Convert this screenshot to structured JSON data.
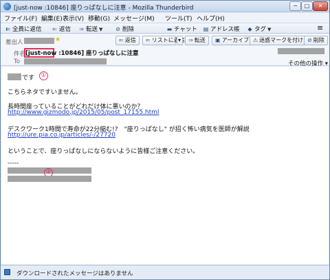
{
  "window": {
    "title": "[just-now :10846] 座りっぱなしに注意 - Mozilla Thunderbird",
    "buttons": {
      "minimize": "─",
      "maximize": "□",
      "close": "✕"
    }
  },
  "menu": [
    "ファイル(F)",
    "編集(E)",
    "表示(V)",
    "移動(G)",
    "メッセージ(M)",
    "ツール(T)",
    "ヘルプ(H)"
  ],
  "toolbar": {
    "get_all": "全員に返信",
    "reply": "返信",
    "forward": "転送",
    "delete": "削除",
    "chat": "チャット",
    "address_book": "アドレス帳",
    "tag": "タグ",
    "menu": "≡"
  },
  "message_actions": {
    "reply": "返信",
    "reply_list": "リストに返信",
    "forward": "転送",
    "archive": "アーカイブ",
    "junk": "迷惑マークを付ける",
    "delete": "削除"
  },
  "header": {
    "from_label": "差出人",
    "subject_label": "件名",
    "to_label": "To",
    "subject_tag": "[just-now",
    "subject_rest": ":10846] 座りっぱなしに注意",
    "other_actions": "その他の操作 ▾"
  },
  "body": {
    "greeting_suffix": "です",
    "marker_1": "①",
    "line1": "こちらネタですいません。",
    "line2": "長時間座っていることがどれだけ体に悪いのか？",
    "link1": "http://www.gizmodo.jp/2015/05/post_17155.html",
    "line3": "デスクワーク1時間で寿命が22分縮む!?　\"座りっぱなし\" が招く怖い病気を医師が解説",
    "link2": "http://ure.pia.co.jp/articles/-/27720",
    "line4": "ということで、座りっぱなしにならないように皆様ご注意ください。",
    "separator": "-----",
    "marker_2": "②"
  },
  "status": {
    "text": "ダウンロードされたメッセージはありません"
  },
  "colors": {
    "annotation": "#e0315a",
    "link": "#1a3ec8",
    "redaction": "#a3a3a3"
  }
}
